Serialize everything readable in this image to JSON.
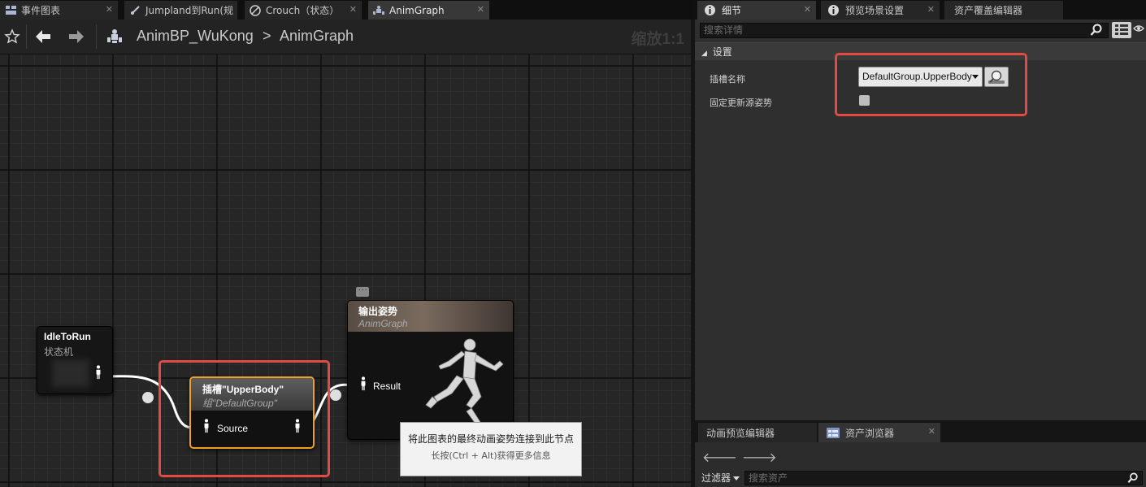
{
  "editor_tabs": [
    {
      "label": "事件图表",
      "icon": "event-graph-icon"
    },
    {
      "label": "Jumpland到Run(规",
      "icon": "transition-icon"
    },
    {
      "label": "Crouch（状态）",
      "icon": "state-icon"
    },
    {
      "label": "AnimGraph",
      "icon": "anim-graph-icon"
    }
  ],
  "breadcrumb": {
    "blueprint": "AnimBP_WuKong",
    "separator": ">",
    "graph": "AnimGraph"
  },
  "zoom_label": "缩放1:1",
  "nodes": {
    "idle_to_run": {
      "title": "IdleToRun",
      "subtitle": "状态机"
    },
    "slot": {
      "title": "插槽\"UpperBody\"",
      "subtitle": "组\"DefaultGroup\"",
      "pin_label": "Source"
    },
    "output_pose": {
      "title": "输出姿势",
      "subtitle": "AnimGraph",
      "pin_label": "Result"
    }
  },
  "tooltip": {
    "line1": "将此图表的最终动画姿势连接到此节点",
    "line2": "长按(Ctrl + Alt)获得更多信息"
  },
  "panel_tabs": [
    {
      "label": "细节",
      "icon": "info-icon"
    },
    {
      "label": "预览场景设置",
      "icon": "info-icon"
    },
    {
      "label": "资产覆盖编辑器",
      "icon": ""
    }
  ],
  "details": {
    "search_placeholder": "搜索详情",
    "section_title": "设置",
    "slot_name_label": "插槽名称",
    "slot_name_value": "DefaultGroup.UpperBody",
    "always_update_label": "固定更新源姿势",
    "always_update_checked": false
  },
  "bottom_tabs": [
    {
      "label": "动画预览编辑器"
    },
    {
      "label": "资产浏览器",
      "icon": "asset-browser-icon"
    }
  ],
  "asset_browser": {
    "filter_label": "过滤器",
    "search_placeholder": "搜索资产"
  },
  "colors": {
    "highlight_red": "#e24a46",
    "selected_node_orange": "#f0a020",
    "wire_white": "#ffffff"
  }
}
